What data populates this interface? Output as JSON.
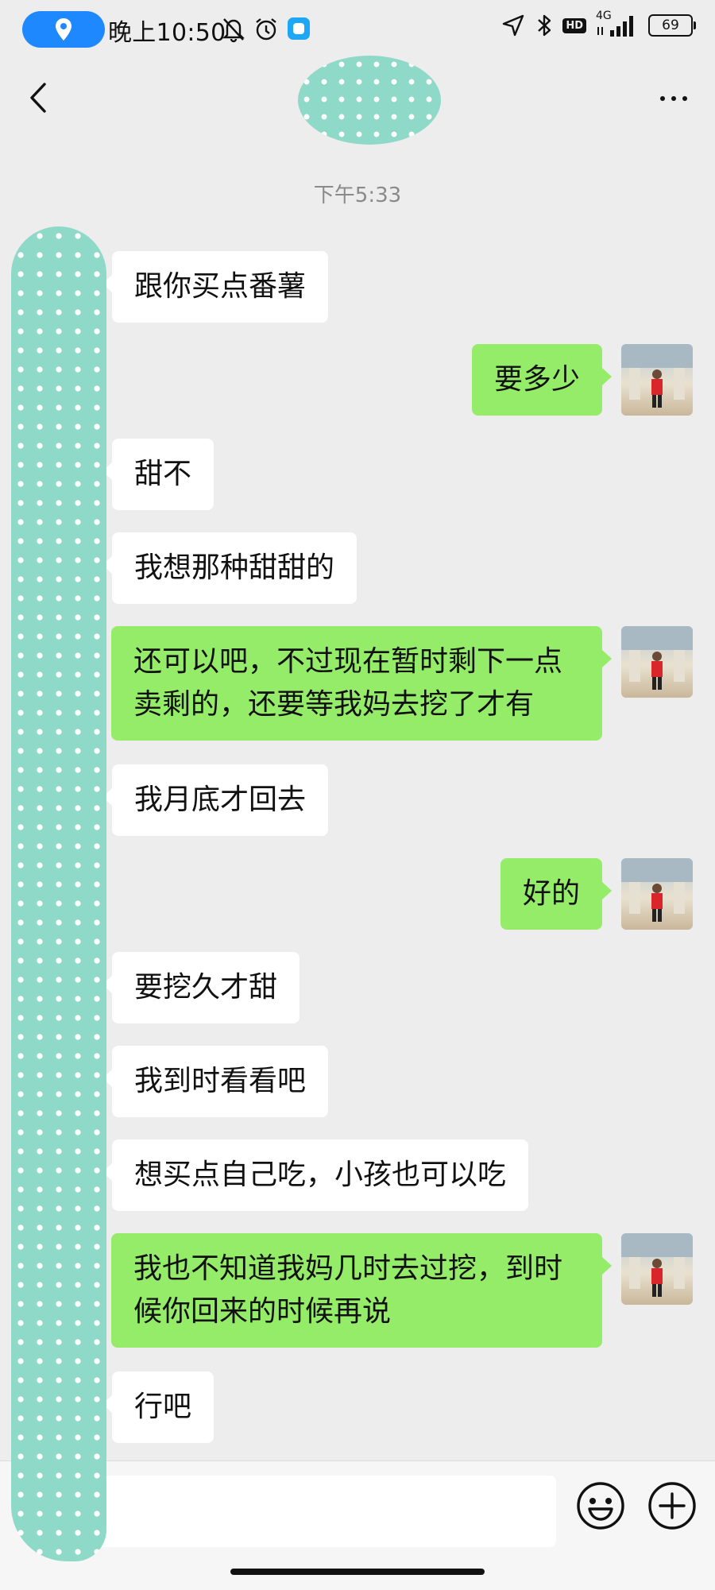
{
  "status_bar": {
    "time": "晚上10:50",
    "network": "4G",
    "battery": "69"
  },
  "header": {},
  "chat": {
    "timestamp": "下午5:33",
    "messages": [
      {
        "side": "in",
        "text": "跟你买点番薯"
      },
      {
        "side": "out",
        "text": "要多少"
      },
      {
        "side": "in",
        "text": "甜不"
      },
      {
        "side": "in",
        "text": "我想那种甜甜的"
      },
      {
        "side": "out",
        "text": "还可以吧，不过现在暂时剩下一点\n卖剩的，还要等我妈去挖了才有"
      },
      {
        "side": "in",
        "text": "我月底才回去"
      },
      {
        "side": "out",
        "text": "好的"
      },
      {
        "side": "in",
        "text": "要挖久才甜"
      },
      {
        "side": "in",
        "text": "我到时看看吧"
      },
      {
        "side": "in",
        "text": "想买点自己吃，小孩也可以吃"
      },
      {
        "side": "out",
        "text": "我也不知道我妈几时去过挖，到时\n候你回来的时候再说"
      },
      {
        "side": "in",
        "text": "行吧"
      }
    ]
  },
  "icons": {
    "back": "chevron-left-icon",
    "more": "more-icon",
    "emoji": "emoji-icon",
    "plus": "plus-icon"
  },
  "colors": {
    "outgoing_bubble": "#95ec69",
    "incoming_bubble": "#ffffff",
    "background": "#ededed"
  }
}
